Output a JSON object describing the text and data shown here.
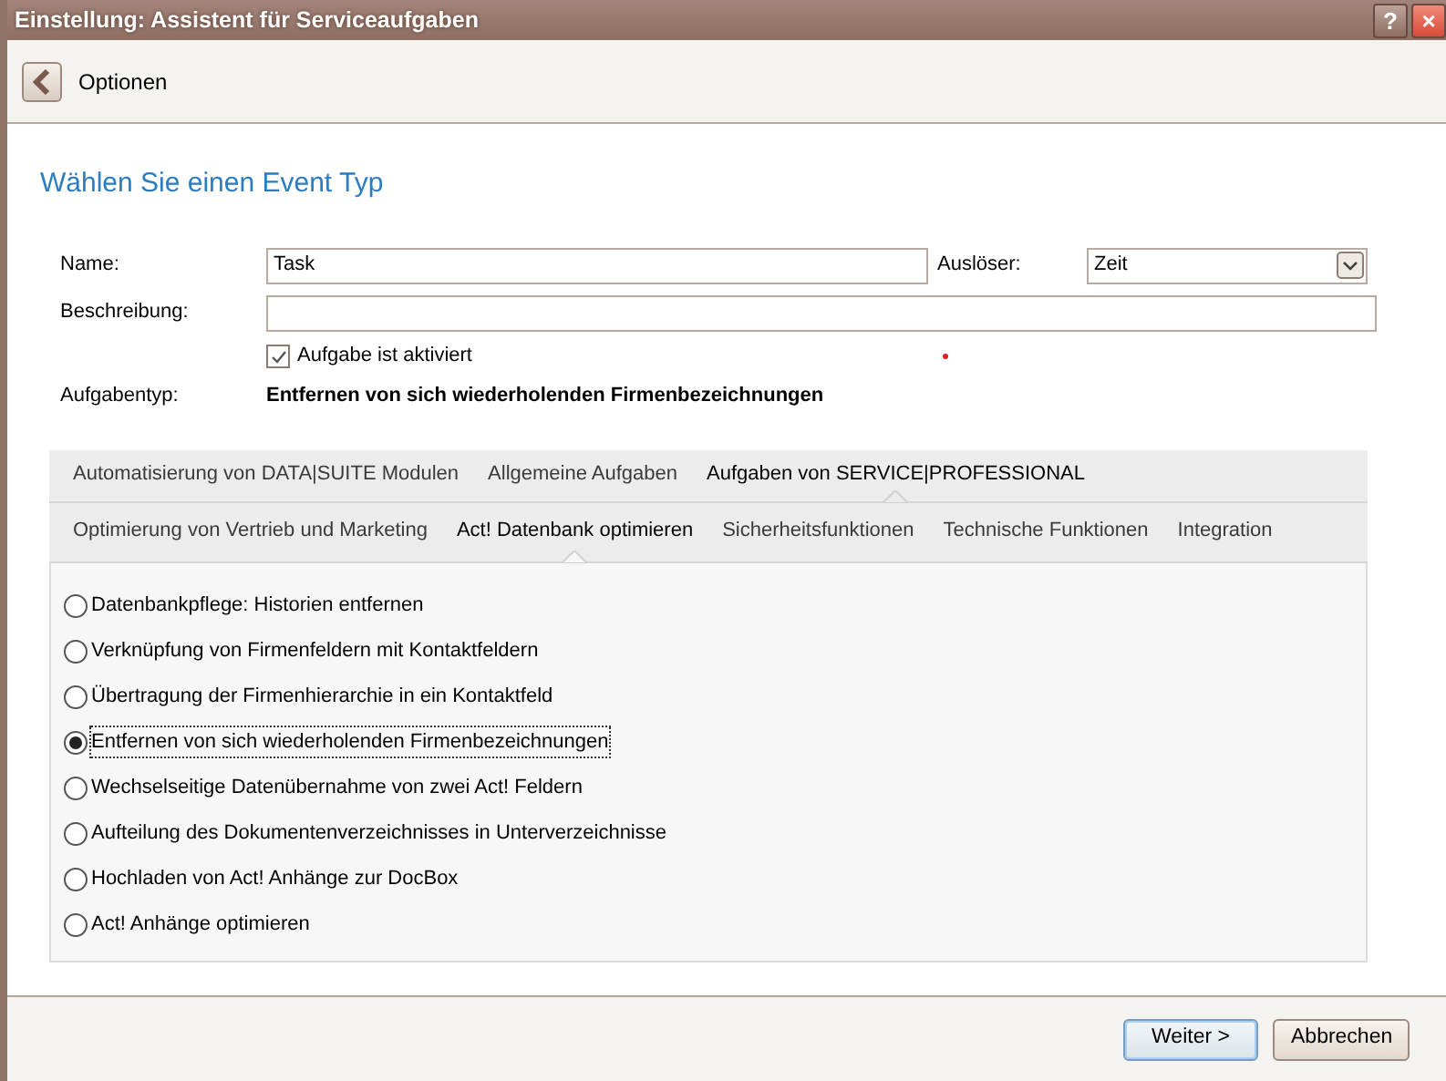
{
  "window": {
    "title": "Einstellung: Assistent für Serviceaufgaben",
    "buttons": [
      "?",
      "×"
    ]
  },
  "toolbar": {
    "label": "Optionen"
  },
  "heading": "Wählen Sie einen Event Typ",
  "form": {
    "name_label": "Name:",
    "name_value": "Task",
    "trigger_label": "Auslöser:",
    "trigger_value": "Zeit",
    "description_label": "Beschreibung:",
    "enabled": {
      "label": "Aufgabe ist aktiviert",
      "checked": true
    },
    "type_label": "Aufgabentyp:",
    "type_value": "Entfernen von sich wiederholenden Firmenbezeichnungen"
  },
  "tab_rows": [
    [
      {
        "label": "Automatisierung von DATA|SUITE Modulen",
        "selected": false
      },
      {
        "label": "Allgemeine Aufgaben",
        "selected": false
      },
      {
        "label": "Aufgaben von SERVICE|PROFESSIONAL",
        "selected": true
      }
    ],
    [
      {
        "label": "Optimierung von Vertrieb und Marketing",
        "selected": false
      },
      {
        "label": "Act! Datenbank optimieren",
        "selected": true
      },
      {
        "label": "Sicherheitsfunktionen",
        "selected": false
      },
      {
        "label": "Technische Funktionen",
        "selected": false
      },
      {
        "label": "Integration",
        "selected": false
      }
    ]
  ],
  "options": [
    {
      "label": "Datenbankpflege: Historien entfernen",
      "selected": false
    },
    {
      "label": "Verknüpfung von Firmenfeldern mit Kontaktfeldern",
      "selected": false
    },
    {
      "label": "Übertragung der Firmenhierarchie in ein Kontaktfeld",
      "selected": false
    },
    {
      "label": "Entfernen von sich wiederholenden Firmenbezeichnungen",
      "selected": true
    },
    {
      "label": "Wechselseitige Datenübernahme von zwei Act! Feldern",
      "selected": false
    },
    {
      "label": "Aufteilung des Dokumentenverzeichnisses in Unterverzeichnisse",
      "selected": false
    },
    {
      "label": "Hochladen von Act! Anhänge zur DocBox",
      "selected": false
    },
    {
      "label": "Act! Anhänge optimieren",
      "selected": false
    }
  ],
  "footer_buttons": [
    {
      "label": "Weiter >",
      "kind": "default"
    },
    {
      "label": "Abbrechen",
      "kind": "normal"
    }
  ]
}
